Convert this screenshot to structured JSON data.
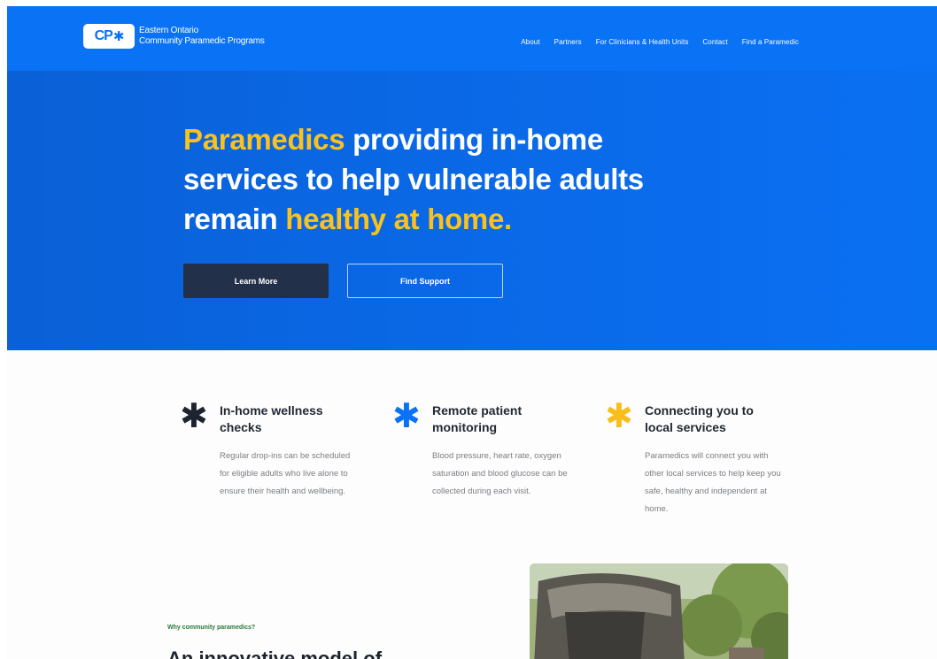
{
  "brand": {
    "logo_mark": "CP",
    "logo_symbol": "✱",
    "line1": "Eastern Ontario",
    "line2": "Community Paramedic Programs"
  },
  "nav": {
    "items": [
      "About",
      "Partners",
      "For Clinicians & Health Units",
      "Contact",
      "Find a Paramedic"
    ]
  },
  "hero": {
    "title_accent1": "Paramedics",
    "title_part1": " providing in-home",
    "title_part2": "services to help vulnerable adults",
    "title_part3": "remain ",
    "title_accent2": "healthy at home.",
    "primary_button": "Learn More",
    "secondary_button": "Find Support"
  },
  "features": [
    {
      "icon": "asterisk-dark-icon",
      "title": "In-home wellness checks",
      "description": "Regular drop-ins can be scheduled for eligible adults who live alone to ensure their health and wellbeing."
    },
    {
      "icon": "asterisk-blue-icon",
      "title": "Remote patient monitoring",
      "description": "Blood pressure, heart rate, oxygen saturation and blood glucose can be collected during each visit."
    },
    {
      "icon": "asterisk-yellow-icon",
      "title": "Connecting you to local services",
      "description": "Paramedics will connect you with other local services to help keep you safe, healthy and independent at home."
    }
  ],
  "why": {
    "label": "Why community paramedics?",
    "heading": "An innovative model of"
  },
  "colors": {
    "brand_blue": "#0a72f5",
    "accent_yellow": "#f9c21f",
    "dark_navy": "#22304a"
  }
}
